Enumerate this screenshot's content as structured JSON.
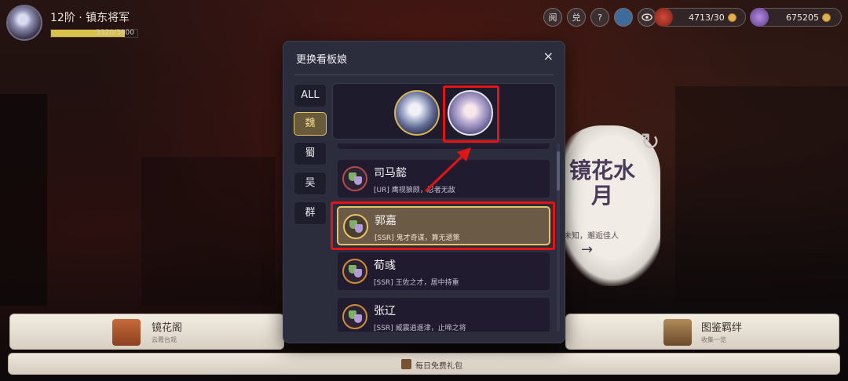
{
  "player": {
    "rank_title": "12阶 · 镇东将军",
    "exp_text": "3320/3900",
    "exp_progress": 0.851
  },
  "topbar": {
    "buttons": [
      "阅",
      "兑",
      "?"
    ],
    "currency1": "4713/30",
    "currency2": "675205"
  },
  "modal": {
    "title": "更换看板娘",
    "close_label": "×",
    "tabs": [
      "ALL",
      "魏",
      "蜀",
      "吴",
      "群"
    ],
    "active_tab": "魏",
    "list": [
      {
        "name": "司马懿",
        "desc": "[UR] 鹰视狼顾，忍者无敌"
      },
      {
        "name": "郭嘉",
        "desc": "[SSR] 鬼才奇谋，算无遗策"
      },
      {
        "name": "荀彧",
        "desc": "[SSR] 王佐之才，居中持重"
      },
      {
        "name": "张辽",
        "desc": "[SSR] 威震逍遥津，止啼之将"
      }
    ],
    "selected_item": "郭嘉"
  },
  "feature": {
    "title": "镜花水月",
    "subtitle": "未知，邂逅佳人",
    "arrow": "→"
  },
  "bottom": {
    "left_title": "镜花阁",
    "left_sub": "云霞台观",
    "right_title": "图鉴羁绊",
    "right_sub": "收集一览",
    "daily": "每日免费礼包"
  },
  "colors": {
    "highlight": "#e21414",
    "active_tab": "#e2c46a",
    "modal_bg": "#2b2d3c"
  }
}
